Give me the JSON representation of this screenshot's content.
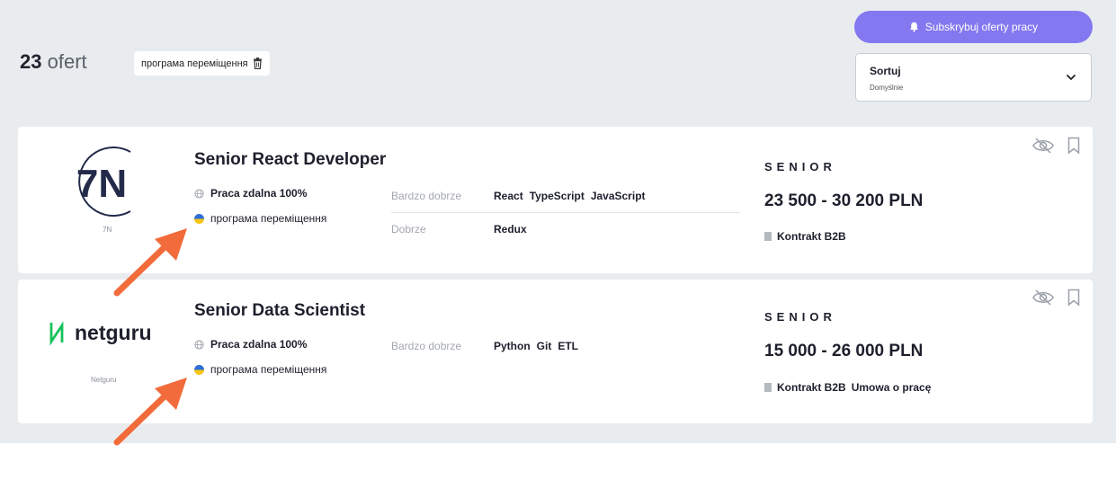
{
  "results": {
    "count": "23",
    "count_label": "ofert"
  },
  "filter_chip": {
    "label": "програма переміщення",
    "icon": "trash-icon"
  },
  "subscribe_button": {
    "label": "Subskrybuj oferty pracy",
    "icon": "bell-icon"
  },
  "sort": {
    "label": "Sortuj",
    "value": "Domyślnie",
    "icon": "chevron-down-icon"
  },
  "offers": [
    {
      "company": "7N",
      "logo_text": "7N",
      "title": "Senior React Developer",
      "work_mode": "Praca zdalna 100%",
      "relocation": "програма переміщення",
      "levels": [
        {
          "label": "Bardzo dobrze",
          "skills": [
            "React",
            "TypeScript",
            "JavaScript"
          ]
        },
        {
          "label": "Dobrze",
          "skills": [
            "Redux"
          ]
        }
      ],
      "seniority": "SENIOR",
      "salary": "23 500 - 30 200 PLN",
      "contracts": [
        "Kontrakt B2B"
      ]
    },
    {
      "company": "Netguru",
      "logo_text": "netguru",
      "title": "Senior Data Scientist",
      "work_mode": "Praca zdalna 100%",
      "relocation": "програма переміщення",
      "levels": [
        {
          "label": "Bardzo dobrze",
          "skills": [
            "Python",
            "Git",
            "ETL"
          ]
        }
      ],
      "seniority": "SENIOR",
      "salary": "15 000 - 26 000 PLN",
      "contracts": [
        "Kontrakt B2B",
        "Umowa o pracę"
      ]
    }
  ],
  "colors": {
    "accent": "#8378f0",
    "annotation_arrow": "#f26b3a",
    "panel_bg": "#e9ecef"
  }
}
